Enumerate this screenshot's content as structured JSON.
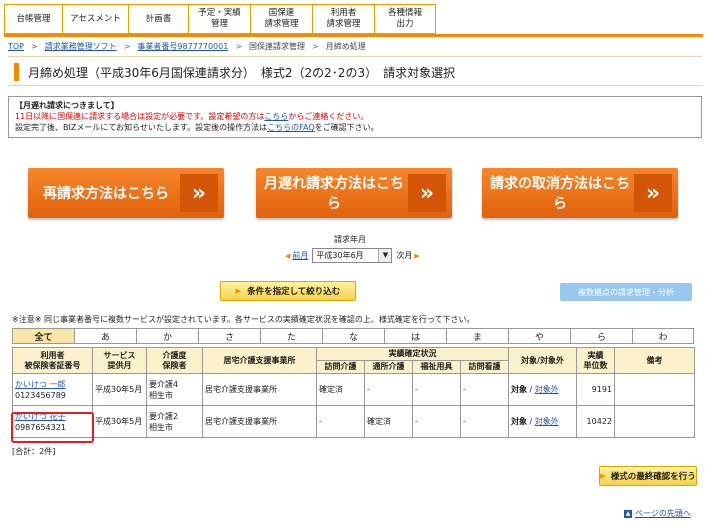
{
  "nav": [
    {
      "label": "台帳管理"
    },
    {
      "label": "アセスメント"
    },
    {
      "label": "計画書"
    },
    {
      "label": "予定・実績\n管理"
    },
    {
      "label": "国保連\n請求管理"
    },
    {
      "label": "利用者\n請求管理"
    },
    {
      "label": "各種情報\n出力"
    }
  ],
  "breadcrumb": {
    "items": [
      "TOP",
      "請求業務管理ソフト",
      "事業者番号9877770001",
      "国保連請求管理",
      "月締め処理"
    ],
    "separator": ">"
  },
  "page_title": "月締め処理（平成30年6月国保連請求分）　様式2（2の2･2の3）　請求対象選択",
  "notice": {
    "heading": "【月遅れ請求につきまして】",
    "line1_red_a": "11日以降に国保連に請求する場合は設定が必要です。設定希望の方は",
    "line1_link": "こちら",
    "line1_red_b": "からご連絡ください。",
    "line2_a": "設定完了後、BIZメールにてお知らせいたします。設定後の操作方法は",
    "line2_link": "こちらのFAQ",
    "line2_b": "をご確認下さい。"
  },
  "action_buttons": {
    "rebill": "再請求方法はこちら",
    "late_bill": "月遅れ請求方法はこちら",
    "cancel": "請求の取消方法はこちら",
    "chevron": "»"
  },
  "period": {
    "label": "請求年月",
    "prev": "前月",
    "selected": "平成30年6月",
    "next": "次月"
  },
  "filter_button": "条件を指定して絞り込む",
  "analysis_button": "複数拠点の請求管理・分析",
  "caution": "※注意※ 同じ事業者番号に複数サービスが設定されています。各サービスの実績確定状況を確認の上、様式確定を行って下さい。",
  "kana_tabs": [
    "全て",
    "あ",
    "か",
    "さ",
    "た",
    "な",
    "は",
    "ま",
    "や",
    "ら",
    "わ"
  ],
  "table": {
    "headers": {
      "user": "利用者\n被保険者証番号",
      "service_month": "サービス\n提供月",
      "care_level": "介護度\n保険者",
      "office": "居宅介護支援事業所",
      "status_group": "実績確定状況",
      "status_cols": [
        "訪問介護",
        "通所介護",
        "福祉用具",
        "訪問看護"
      ],
      "target": "対象/対象外",
      "units": "実績\n単位数",
      "note": "備考"
    },
    "rows": [
      {
        "name": "かいけつ 一郎",
        "id": "0123456789",
        "month": "平成30年5月",
        "care": "要介護4",
        "insurer": "相生市",
        "office": "居宅介護支援事業所",
        "status": [
          "確定済",
          "-",
          "-",
          "-"
        ],
        "target": "対象",
        "exclude": "対象外",
        "units": "9191",
        "note": ""
      },
      {
        "name": "かいけつ 花子",
        "id": "0987654321",
        "month": "平成30年5月",
        "care": "要介護2",
        "insurer": "相生市",
        "office": "居宅介護支援事業所",
        "status": [
          "-",
          "確定済",
          "-",
          "-"
        ],
        "target": "対象",
        "exclude": "対象外",
        "units": "10422",
        "note": ""
      }
    ]
  },
  "total": "[合計：2件]",
  "confirm_button": "様式の最終確認を行う",
  "page_top": "ページの先頭へ",
  "colors": {
    "accent": "#f08c00",
    "big_button": "#ec6e16",
    "header_bg": "#fbf2cc",
    "highlight": "#e02020",
    "link": "#2255aa"
  }
}
